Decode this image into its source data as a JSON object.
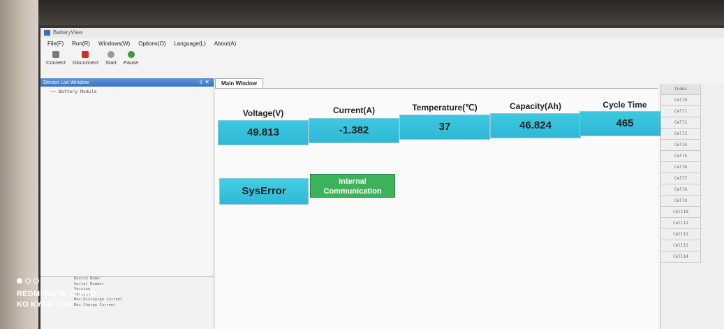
{
  "app": {
    "title": "BatteryView"
  },
  "menu": [
    "File(F)",
    "Run(R)",
    "Windows(W)",
    "Options(O)",
    "Language(L)",
    "About(A)"
  ],
  "toolbar": {
    "connect": "Connect",
    "disconnect": "Disconnect",
    "start": "Start",
    "pause": "Pause"
  },
  "device_list": {
    "title": "Device List Window",
    "pin": "⇩ ✕",
    "tree_item": "Battery Module"
  },
  "info_lines": [
    "Device Name:",
    "Serial Number",
    "Version",
    "Version",
    "Max Discharge Current",
    "Max Charge Current"
  ],
  "tab": {
    "label": "Main Window"
  },
  "metrics": [
    {
      "label": "Voltage(V)",
      "value": "49.813"
    },
    {
      "label": "Current(A)",
      "value": "-1.382"
    },
    {
      "label": "Temperature(℃)",
      "value": "37"
    },
    {
      "label": "Capacity(Ah)",
      "value": "46.824"
    },
    {
      "label": "Cycle Time",
      "value": "465"
    }
  ],
  "status": {
    "sys_error": "SysError",
    "comm_line1": "Internal",
    "comm_line2": "Communication"
  },
  "cell_table": {
    "header": "Index",
    "rows": [
      "Cell0",
      "Cell1",
      "Cell2",
      "Cell3",
      "Cell4",
      "Cell5",
      "Cell6",
      "Cell7",
      "Cell8",
      "Cell9",
      "Cell10",
      "Cell11",
      "Cell12",
      "Cell13",
      "Cell14"
    ]
  },
  "overlay": {
    "line1": "REDMI NOTE 11 PRO",
    "line2": "KO KYAW THU"
  },
  "colors": {
    "value_box": "#2fb8d6",
    "comm_ok": "#3cb35a",
    "panel_header": "#3a73c0"
  }
}
